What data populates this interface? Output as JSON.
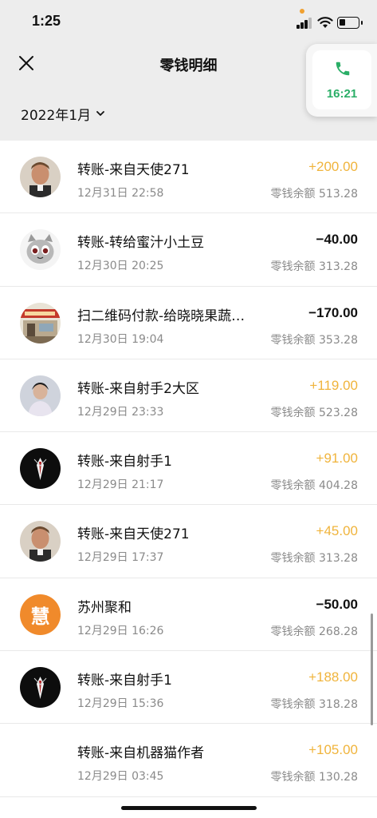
{
  "status_bar": {
    "time": "1:25"
  },
  "nav": {
    "title": "零钱明细"
  },
  "filter": {
    "month": "2022年1月"
  },
  "call": {
    "duration": "16:21",
    "color": "#2aae67"
  },
  "colors": {
    "income": "#f0b43c",
    "expense": "#111111",
    "muted": "#8a8a8a"
  },
  "balance_prefix": "零钱余额",
  "transactions": [
    {
      "title": "转账-来自天使271",
      "date": "12月31日 22:58",
      "amount": "+200.00",
      "type": "in",
      "balance": "513.28",
      "avatar": "portrait-avatar"
    },
    {
      "title": "转账-转给蜜汁小土豆",
      "date": "12月30日 20:25",
      "amount": "−40.00",
      "type": "out",
      "balance": "313.28",
      "avatar": "cat-avatar"
    },
    {
      "title": "扫二维码付款-给晓晓果蔬…",
      "date": "12月30日 19:04",
      "amount": "−170.00",
      "type": "out",
      "balance": "353.28",
      "avatar": "shop-avatar"
    },
    {
      "title": "转账-来自射手2大区",
      "date": "12月29日 23:33",
      "amount": "+119.00",
      "type": "in",
      "balance": "523.28",
      "avatar": "person-avatar"
    },
    {
      "title": "转账-来自射手1",
      "date": "12月29日 21:17",
      "amount": "+91.00",
      "type": "in",
      "balance": "404.28",
      "avatar": "suit-avatar"
    },
    {
      "title": "转账-来自天使271",
      "date": "12月29日 17:37",
      "amount": "+45.00",
      "type": "in",
      "balance": "313.28",
      "avatar": "portrait-avatar"
    },
    {
      "title": "苏州聚和",
      "date": "12月29日 16:26",
      "amount": "−50.00",
      "type": "out",
      "balance": "268.28",
      "avatar": "hui-avatar",
      "avatar_glyph": "慧"
    },
    {
      "title": "转账-来自射手1",
      "date": "12月29日 15:36",
      "amount": "+188.00",
      "type": "in",
      "balance": "318.28",
      "avatar": "suit-avatar"
    },
    {
      "title": "转账-来自机器猫作者",
      "date": "12月29日 03:45",
      "amount": "+105.00",
      "type": "in",
      "balance": "130.28",
      "avatar": "none"
    }
  ]
}
